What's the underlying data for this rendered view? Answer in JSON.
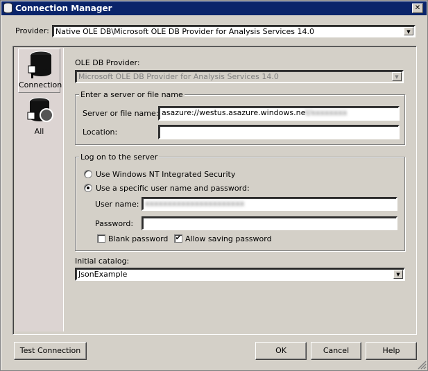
{
  "window": {
    "title": "Connection Manager",
    "close": "✕"
  },
  "provider": {
    "label": "Provider:",
    "value": "Native OLE DB\\Microsoft OLE DB Provider for Analysis Services 14.0"
  },
  "sidebar": {
    "items": [
      {
        "label": "Connection",
        "selected": true
      },
      {
        "label": "All",
        "selected": false
      }
    ]
  },
  "ole_db": {
    "label": "OLE DB Provider:",
    "value": "Microsoft OLE DB Provider for Analysis Services 14.0"
  },
  "server_group": {
    "title": "Enter a server or file name",
    "server_label": "Server or file name:",
    "server_value": "asazure://westus.asazure.windows.ne",
    "server_redacted": "t/xxxxxxxx",
    "location_label": "Location:",
    "location_value": ""
  },
  "logon_group": {
    "title": "Log on to the server",
    "radio_windows": "Use Windows NT Integrated Security",
    "radio_specific": "Use a specific user name and password:",
    "selected": "specific",
    "username_label": "User name:",
    "username_value": "xxxxxxxxxxxxxxxxxxxxxx",
    "password_label": "Password:",
    "blank_password": "Blank password",
    "blank_checked": false,
    "allow_saving": "Allow saving password",
    "allow_checked": true
  },
  "catalog": {
    "label": "Initial catalog:",
    "value": "JsonExample"
  },
  "buttons": {
    "test": "Test Connection",
    "ok": "OK",
    "cancel": "Cancel",
    "help": "Help"
  }
}
